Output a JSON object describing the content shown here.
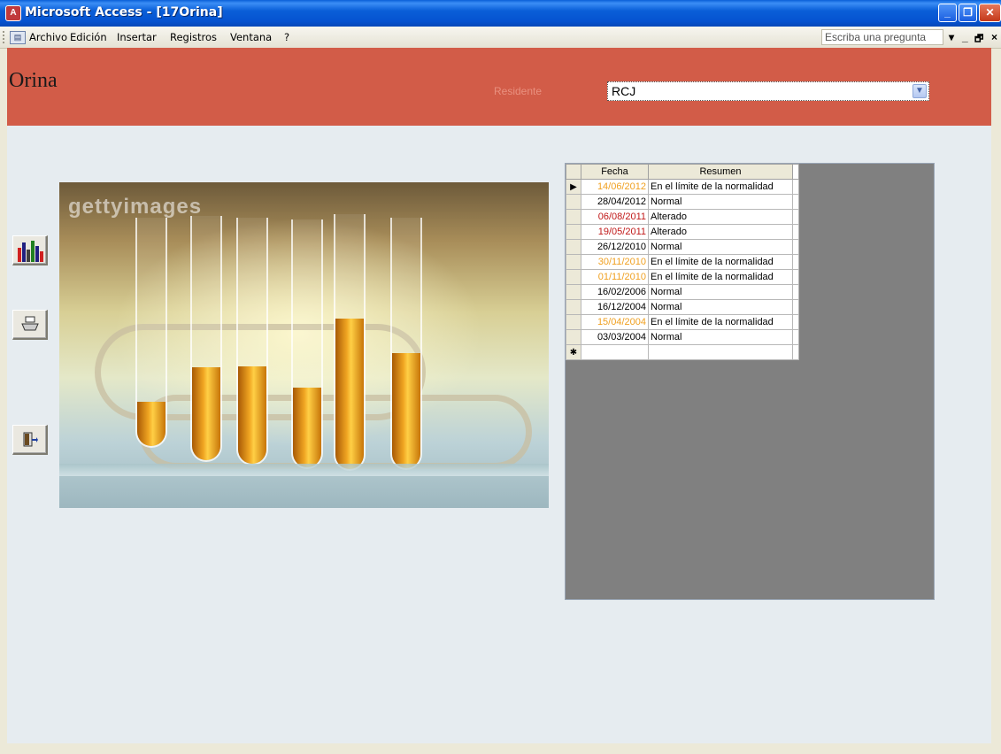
{
  "window": {
    "title": "Microsoft Access - [17Orina]",
    "app_icon": "access-icon",
    "controls": [
      "_",
      "❐",
      "✕"
    ]
  },
  "menu": {
    "items": [
      "Archivo",
      "Edición",
      "Insertar",
      "Registros",
      "Ventana",
      "?"
    ],
    "ask_placeholder": "Escriba una pregunta",
    "doc_controls": [
      "▾",
      "_",
      "🗗",
      "×"
    ]
  },
  "form": {
    "title": "Orina",
    "resident_label": "Residente",
    "resident_value": "RCJ",
    "header_color": "#d25c48",
    "photo_watermark": "gettyimages",
    "side_buttons": [
      "chart-report-icon",
      "print-icon",
      "exit-door-icon"
    ]
  },
  "grid": {
    "columns": [
      "Fecha",
      "Resumen"
    ],
    "rows": [
      {
        "fecha": "14/06/2012",
        "resumen": "En el límite de la normalidad",
        "color": "orange",
        "current": true
      },
      {
        "fecha": "28/04/2012",
        "resumen": "Normal",
        "color": "black"
      },
      {
        "fecha": "06/08/2011",
        "resumen": "Alterado",
        "color": "red"
      },
      {
        "fecha": "19/05/2011",
        "resumen": "Alterado",
        "color": "red"
      },
      {
        "fecha": "26/12/2010",
        "resumen": "Normal",
        "color": "black"
      },
      {
        "fecha": "30/11/2010",
        "resumen": "En el límite de la normalidad",
        "color": "orange"
      },
      {
        "fecha": "01/11/2010",
        "resumen": "En el límite de la normalidad",
        "color": "orange"
      },
      {
        "fecha": "16/02/2006",
        "resumen": "Normal",
        "color": "black"
      },
      {
        "fecha": "16/12/2004",
        "resumen": "Normal",
        "color": "black"
      },
      {
        "fecha": "15/04/2004",
        "resumen": "En el límite de la normalidad",
        "color": "orange"
      },
      {
        "fecha": "03/03/2004",
        "resumen": "Normal",
        "color": "black"
      }
    ],
    "current_marker": "▶",
    "new_row_marker": "✱"
  }
}
